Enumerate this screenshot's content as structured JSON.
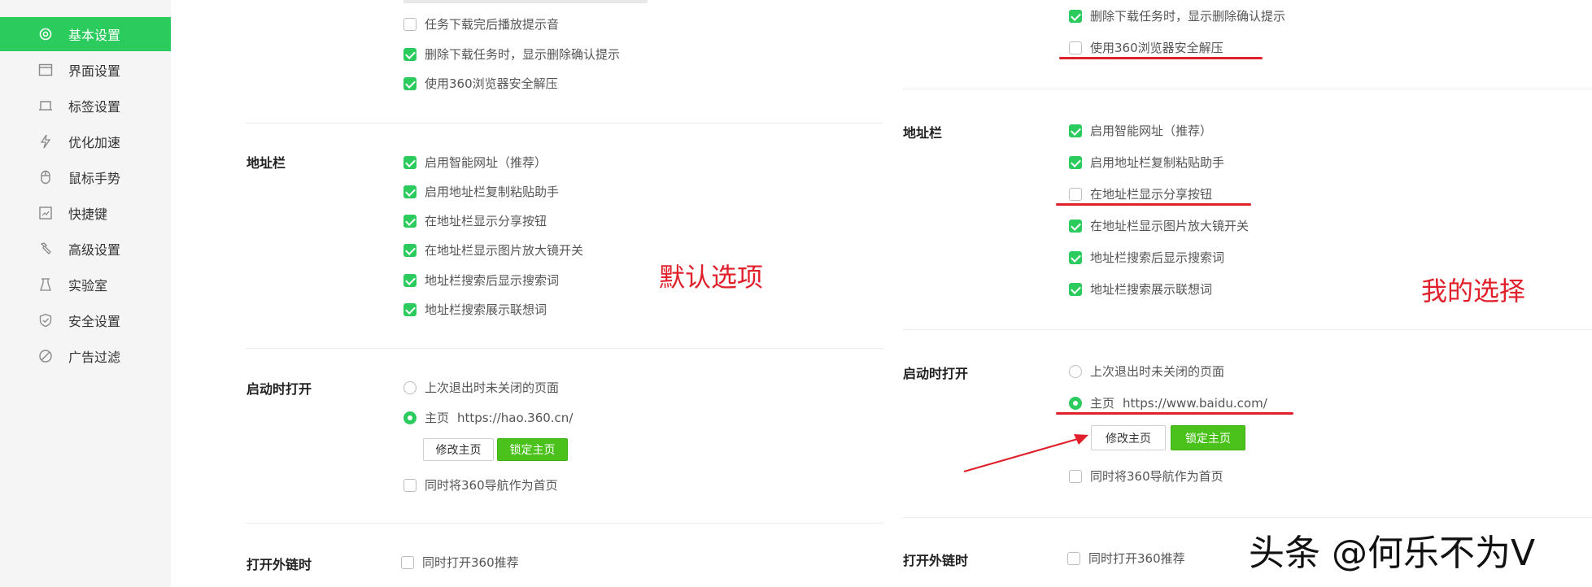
{
  "sidebar": {
    "items": [
      {
        "label": "基本设置",
        "icon": "gear-icon",
        "active": true
      },
      {
        "label": "界面设置",
        "icon": "window-icon"
      },
      {
        "label": "标签设置",
        "icon": "tab-icon"
      },
      {
        "label": "优化加速",
        "icon": "lightning-icon"
      },
      {
        "label": "鼠标手势",
        "icon": "mouse-icon"
      },
      {
        "label": "快捷键",
        "icon": "keyboard-icon"
      },
      {
        "label": "高级设置",
        "icon": "wrench-icon"
      },
      {
        "label": "实验室",
        "icon": "flask-icon"
      },
      {
        "label": "安全设置",
        "icon": "shield-icon"
      },
      {
        "label": "广告过滤",
        "icon": "block-icon"
      }
    ]
  },
  "left_panel": {
    "download": {
      "options": [
        {
          "label": "任务下载完后播放提示音",
          "checked": false
        },
        {
          "label": "删除下载任务时，显示删除确认提示",
          "checked": true
        },
        {
          "label": "使用360浏览器安全解压",
          "checked": true
        }
      ]
    },
    "address_bar": {
      "title": "地址栏",
      "options": [
        {
          "label": "启用智能网址（推荐）",
          "checked": true
        },
        {
          "label": "启用地址栏复制粘贴助手",
          "checked": true
        },
        {
          "label": "在地址栏显示分享按钮",
          "checked": true
        },
        {
          "label": "在地址栏显示图片放大镜开关",
          "checked": true
        },
        {
          "label": "地址栏搜索后显示搜索词",
          "checked": true
        },
        {
          "label": "地址栏搜索展示联想词",
          "checked": true
        }
      ]
    },
    "startup": {
      "title": "启动时打开",
      "radio_last": "上次退出时未关闭的页面",
      "radio_home": "主页",
      "home_url": "https://hao.360.cn/",
      "modify_btn": "修改主页",
      "lock_btn": "锁定主页",
      "nav_option": "同时将360导航作为首页"
    },
    "external": {
      "title": "打开外链时",
      "option": "同时打开360推荐"
    },
    "annotation": "默认选项"
  },
  "right_panel": {
    "download": {
      "options": [
        {
          "label": "删除下载任务时，显示删除确认提示",
          "checked": true
        },
        {
          "label": "使用360浏览器安全解压",
          "checked": false
        }
      ]
    },
    "address_bar": {
      "title": "地址栏",
      "options": [
        {
          "label": "启用智能网址（推荐）",
          "checked": true
        },
        {
          "label": "启用地址栏复制粘贴助手",
          "checked": true
        },
        {
          "label": "在地址栏显示分享按钮",
          "checked": false
        },
        {
          "label": "在地址栏显示图片放大镜开关",
          "checked": true
        },
        {
          "label": "地址栏搜索后显示搜索词",
          "checked": true
        },
        {
          "label": "地址栏搜索展示联想词",
          "checked": true
        }
      ]
    },
    "startup": {
      "title": "启动时打开",
      "radio_last": "上次退出时未关闭的页面",
      "radio_home": "主页",
      "home_url": "https://www.baidu.com/",
      "modify_btn": "修改主页",
      "lock_btn": "锁定主页",
      "nav_option": "同时将360导航作为首页"
    },
    "external": {
      "title": "打开外链时",
      "option": "同时打开360推荐"
    },
    "annotation": "我的选择"
  },
  "watermark": "头条 @何乐不为V",
  "colors": {
    "accent": "#2bcb5e",
    "button_green": "#4bc21b",
    "annotation_red": "#e0202a"
  }
}
